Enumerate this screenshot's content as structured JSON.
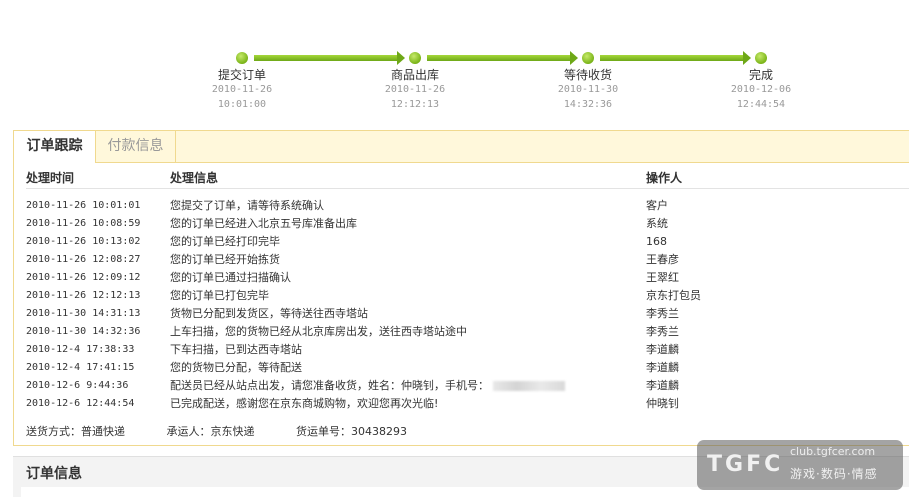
{
  "progress": {
    "steps": [
      {
        "label": "提交订单",
        "date": "2010-11-26",
        "time": "10:01:00"
      },
      {
        "label": "商品出库",
        "date": "2010-11-26",
        "time": "12:12:13"
      },
      {
        "label": "等待收货",
        "date": "2010-11-30",
        "time": "14:32:36"
      },
      {
        "label": "完成",
        "date": "2010-12-06",
        "time": "12:44:54"
      }
    ]
  },
  "tabs": {
    "active": "订单跟踪",
    "inactive": "付款信息"
  },
  "table": {
    "headers": {
      "time": "处理时间",
      "info": "处理信息",
      "operator": "操作人"
    },
    "rows": [
      {
        "time": "2010-11-26 10:01:01",
        "info": "您提交了订单，请等待系统确认",
        "operator": "客户"
      },
      {
        "time": "2010-11-26 10:08:59",
        "info": "您的订单已经进入北京五号库准备出库",
        "operator": "系统"
      },
      {
        "time": "2010-11-26 10:13:02",
        "info": "您的订单已经打印完毕",
        "operator": "168"
      },
      {
        "time": "2010-11-26 12:08:27",
        "info": "您的订单已经开始拣货",
        "operator": "王春彦"
      },
      {
        "time": "2010-11-26 12:09:12",
        "info": "您的订单已通过扫描确认",
        "operator": "王翠红"
      },
      {
        "time": "2010-11-26 12:12:13",
        "info": "您的订单已打包完毕",
        "operator": "京东打包员"
      },
      {
        "time": "2010-11-30 14:31:13",
        "info": "货物已分配到发货区，等待送往西寺塔站",
        "operator": "李秀兰"
      },
      {
        "time": "2010-11-30 14:32:36",
        "info": "上车扫描，您的货物已经从北京库房出发，送往西寺塔站途中",
        "operator": "李秀兰"
      },
      {
        "time": "2010-12-4 17:38:33",
        "info": "下车扫描，已到达西寺塔站",
        "operator": "李道麟"
      },
      {
        "time": "2010-12-4 17:41:15",
        "info": "您的货物已分配，等待配送",
        "operator": "李道麟"
      },
      {
        "time": "2010-12-6 9:44:36",
        "info": "配送员已经从站点出发，请您准备收货，姓名：仲晓钊，手机号：",
        "operator": "李道麟"
      },
      {
        "time": "2010-12-6 12:44:54",
        "info": "已完成配送，感谢您在京东商城购物，欢迎您再次光临!",
        "operator": "仲晓钊"
      }
    ]
  },
  "shipping": {
    "method": "送货方式：普通快递",
    "carrier": "承运人：京东快递",
    "tracking": "货运单号：30438293"
  },
  "order_info": {
    "title": "订单信息"
  },
  "watermark": {
    "logo": "TGFC",
    "site": "club.tgfcer.com",
    "tagline": "游戏·数码·情感"
  }
}
